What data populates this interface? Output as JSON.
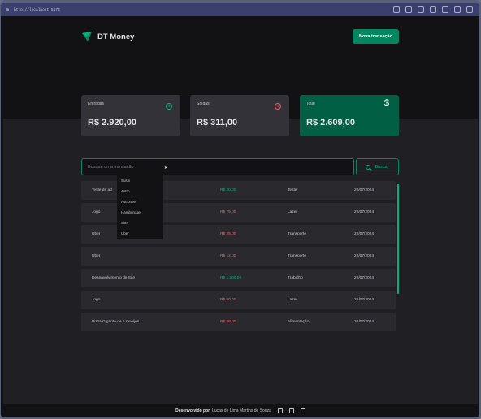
{
  "browser": {
    "url": "http://localhost:5173"
  },
  "header": {
    "app_name": "DT Money",
    "new_transaction_label": "Nova transação"
  },
  "summary": {
    "income": {
      "label": "Entradas",
      "value": "R$ 2.920,00"
    },
    "outcome": {
      "label": "Saídas",
      "value": "R$ 311,00"
    },
    "total": {
      "label": "Total",
      "value": "R$ 2.609,00",
      "symbol": "$"
    }
  },
  "search": {
    "placeholder": "Busque uma transação",
    "button_label": "Buscar"
  },
  "autocomplete": [
    "Sushi",
    "Astro",
    "Astroneer",
    "Hamburguer",
    "Site",
    "Uber"
  ],
  "transactions": [
    {
      "description": "Teste de ad",
      "amount": "R$ 20,00",
      "type": "income",
      "category": "Teste",
      "date": "22/07/2024"
    },
    {
      "description": "Jogo",
      "amount": "R$ 75,00",
      "type": "outcome",
      "category": "Lazer",
      "date": "22/07/2024"
    },
    {
      "description": "Uber",
      "amount": "R$ 25,00",
      "type": "outcome",
      "category": "Transporte",
      "date": "22/07/2024"
    },
    {
      "description": "Uber",
      "amount": "R$ 12,00",
      "type": "outcome",
      "category": "Transporte",
      "date": "22/07/2024"
    },
    {
      "description": "Desenvolvimento de Site",
      "amount": "R$ 1.500,00",
      "type": "income",
      "category": "Trabalho",
      "date": "22/07/2024"
    },
    {
      "description": "Jogo",
      "amount": "R$ 60,00",
      "type": "outcome",
      "category": "Lazer",
      "date": "26/07/2024"
    },
    {
      "description": "Pizza Gigante de 5 Queijos",
      "amount": "R$ 89,00",
      "type": "outcome",
      "category": "Alimentação",
      "date": "26/07/2024"
    }
  ],
  "footer": {
    "prefix": "Desenvolvido por",
    "author": "Lucas de Lima Martins de Souza"
  },
  "colors": {
    "accent": "#00875f",
    "income": "#00b37e",
    "outcome": "#f75a68"
  }
}
